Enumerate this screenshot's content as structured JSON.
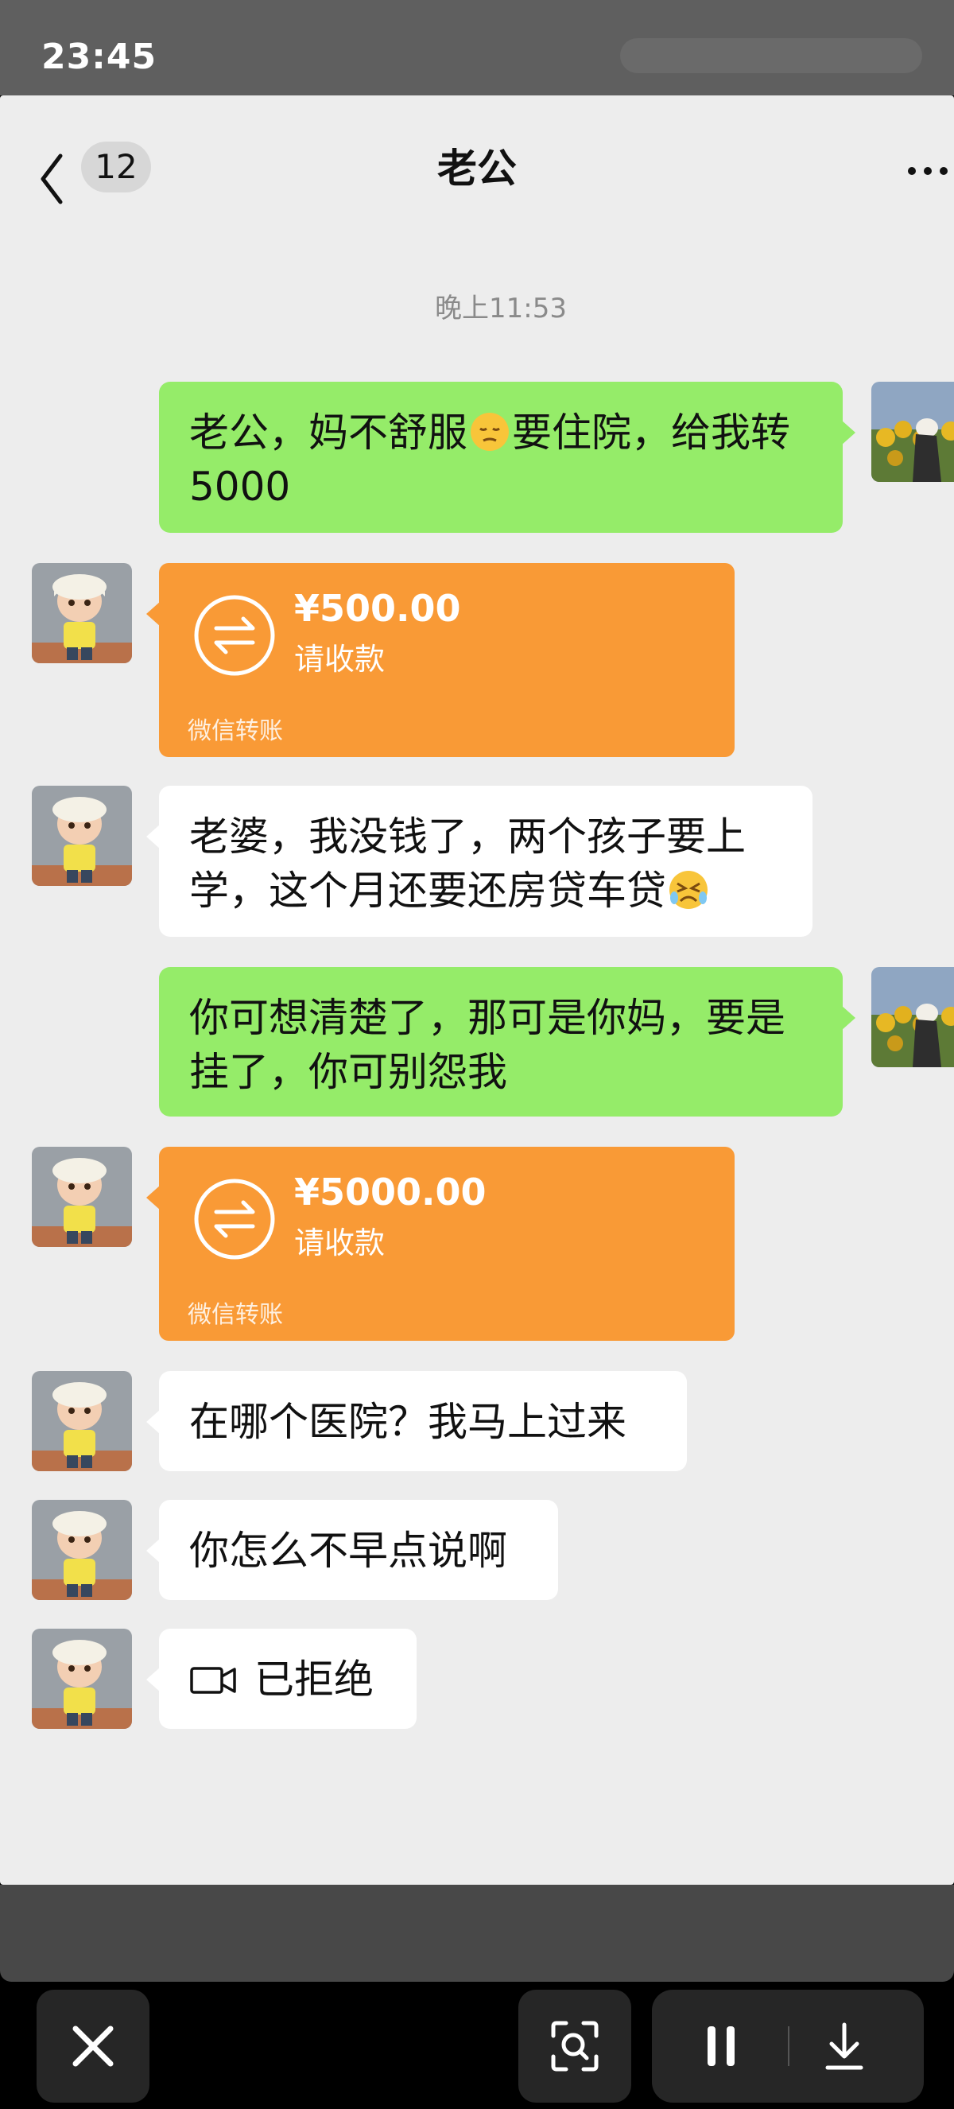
{
  "status_bar": {
    "time": "23:45"
  },
  "header": {
    "back_icon": "chevron-left-icon",
    "unread_count": "12",
    "title": "老公",
    "more_icon": "ellipsis-icon"
  },
  "timestamp": "晚上11:53",
  "messages": [
    {
      "type": "text",
      "from": "self",
      "line1": "老公，妈不舒服",
      "emoji": "pensive-face-emoji",
      "line1b": "要住院，给我转",
      "line2": "5000"
    },
    {
      "type": "transfer",
      "from": "husband",
      "amount": "¥500.00",
      "status": "请收款",
      "footer": "微信转账"
    },
    {
      "type": "text",
      "from": "husband",
      "line1": "老婆，我没钱了，两个孩子要上",
      "line2": "学，这个月还要还房贷车贷",
      "emoji": "crying-angry-face-emoji"
    },
    {
      "type": "text",
      "from": "self",
      "line1": "你可想清楚了，那可是你妈，要是",
      "line2": "挂了，你可别怨我"
    },
    {
      "type": "transfer",
      "from": "husband",
      "amount": "¥5000.00",
      "status": "请收款",
      "footer": "微信转账"
    },
    {
      "type": "text",
      "from": "husband",
      "text": "在哪个医院？我马上过来"
    },
    {
      "type": "text",
      "from": "husband",
      "text": "你怎么不早点说啊"
    },
    {
      "type": "call",
      "from": "husband",
      "icon": "video-call-icon",
      "text": "已拒绝"
    }
  ],
  "controls": {
    "close_icon": "close-icon",
    "scan_icon": "scan-icon",
    "pause_icon": "pause-icon",
    "download_icon": "download-icon"
  },
  "colors": {
    "bubble_self": "#95ec69",
    "bubble_other": "#ffffff",
    "transfer": "#f99a36",
    "chat_bg": "#ededed"
  }
}
